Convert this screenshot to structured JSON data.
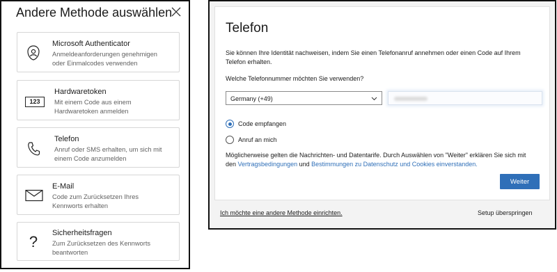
{
  "left_panel": {
    "title": "Andere Methode auswählen",
    "methods": [
      {
        "name": "Microsoft Authenticator",
        "desc_line1": "Anmeldeanforderungen genehmigen",
        "desc_line2": "oder Einmalcodes verwenden",
        "icon": "authenticator-lock-icon"
      },
      {
        "name": "Hardwaretoken",
        "desc_line1": "Mit einem Code aus einem",
        "desc_line2": "Hardwaretoken anmelden",
        "icon": "hardware-token-icon",
        "icon_text": "123"
      },
      {
        "name": "Telefon",
        "desc_line1": "Anruf oder SMS erhalten, um sich mit",
        "desc_line2": "einem Code anzumelden",
        "icon": "phone-icon"
      },
      {
        "name": "E-Mail",
        "desc_line1": "Code zum Zurücksetzen Ihres",
        "desc_line2": "Kennworts erhalten",
        "icon": "mail-icon"
      },
      {
        "name": "Sicherheitsfragen",
        "desc_line1": "Zum Zurücksetzen des Kennworts",
        "desc_line2": "beantworten",
        "icon": "question-icon",
        "icon_text": "?"
      }
    ]
  },
  "right_panel": {
    "heading": "Telefon",
    "intro_line1": "Sie können Ihre Identität nachweisen, indem Sie einen Telefonanruf annehmen oder einen Code auf Ihrem",
    "intro_line2": "Telefon erhalten.",
    "question": "Welche Telefonnummer möchten Sie verwenden?",
    "country_select": "Germany (+49)",
    "options": [
      {
        "label": "Code empfangen",
        "selected": true
      },
      {
        "label": "Anruf an mich",
        "selected": false
      }
    ],
    "terms_line1": "Möglicherweise gelten die Nachrichten- und Datentarife. Durch Auswählen von \"Weiter\" erklären Sie sich mit",
    "terms_prefix": "den ",
    "terms_link1": "Vertragsbedingungen",
    "terms_and": " und ",
    "terms_link2": "Bestimmungen zu Datenschutz und Cookies einverstanden.",
    "next_button": "Weiter",
    "other_method_link": "Ich möchte eine andere Methode einrichten.",
    "skip_setup": "Setup überspringen",
    "colors": {
      "accent": "#2f6fb8",
      "border": "#111111",
      "footer_bg": "#f3f3f3"
    }
  }
}
